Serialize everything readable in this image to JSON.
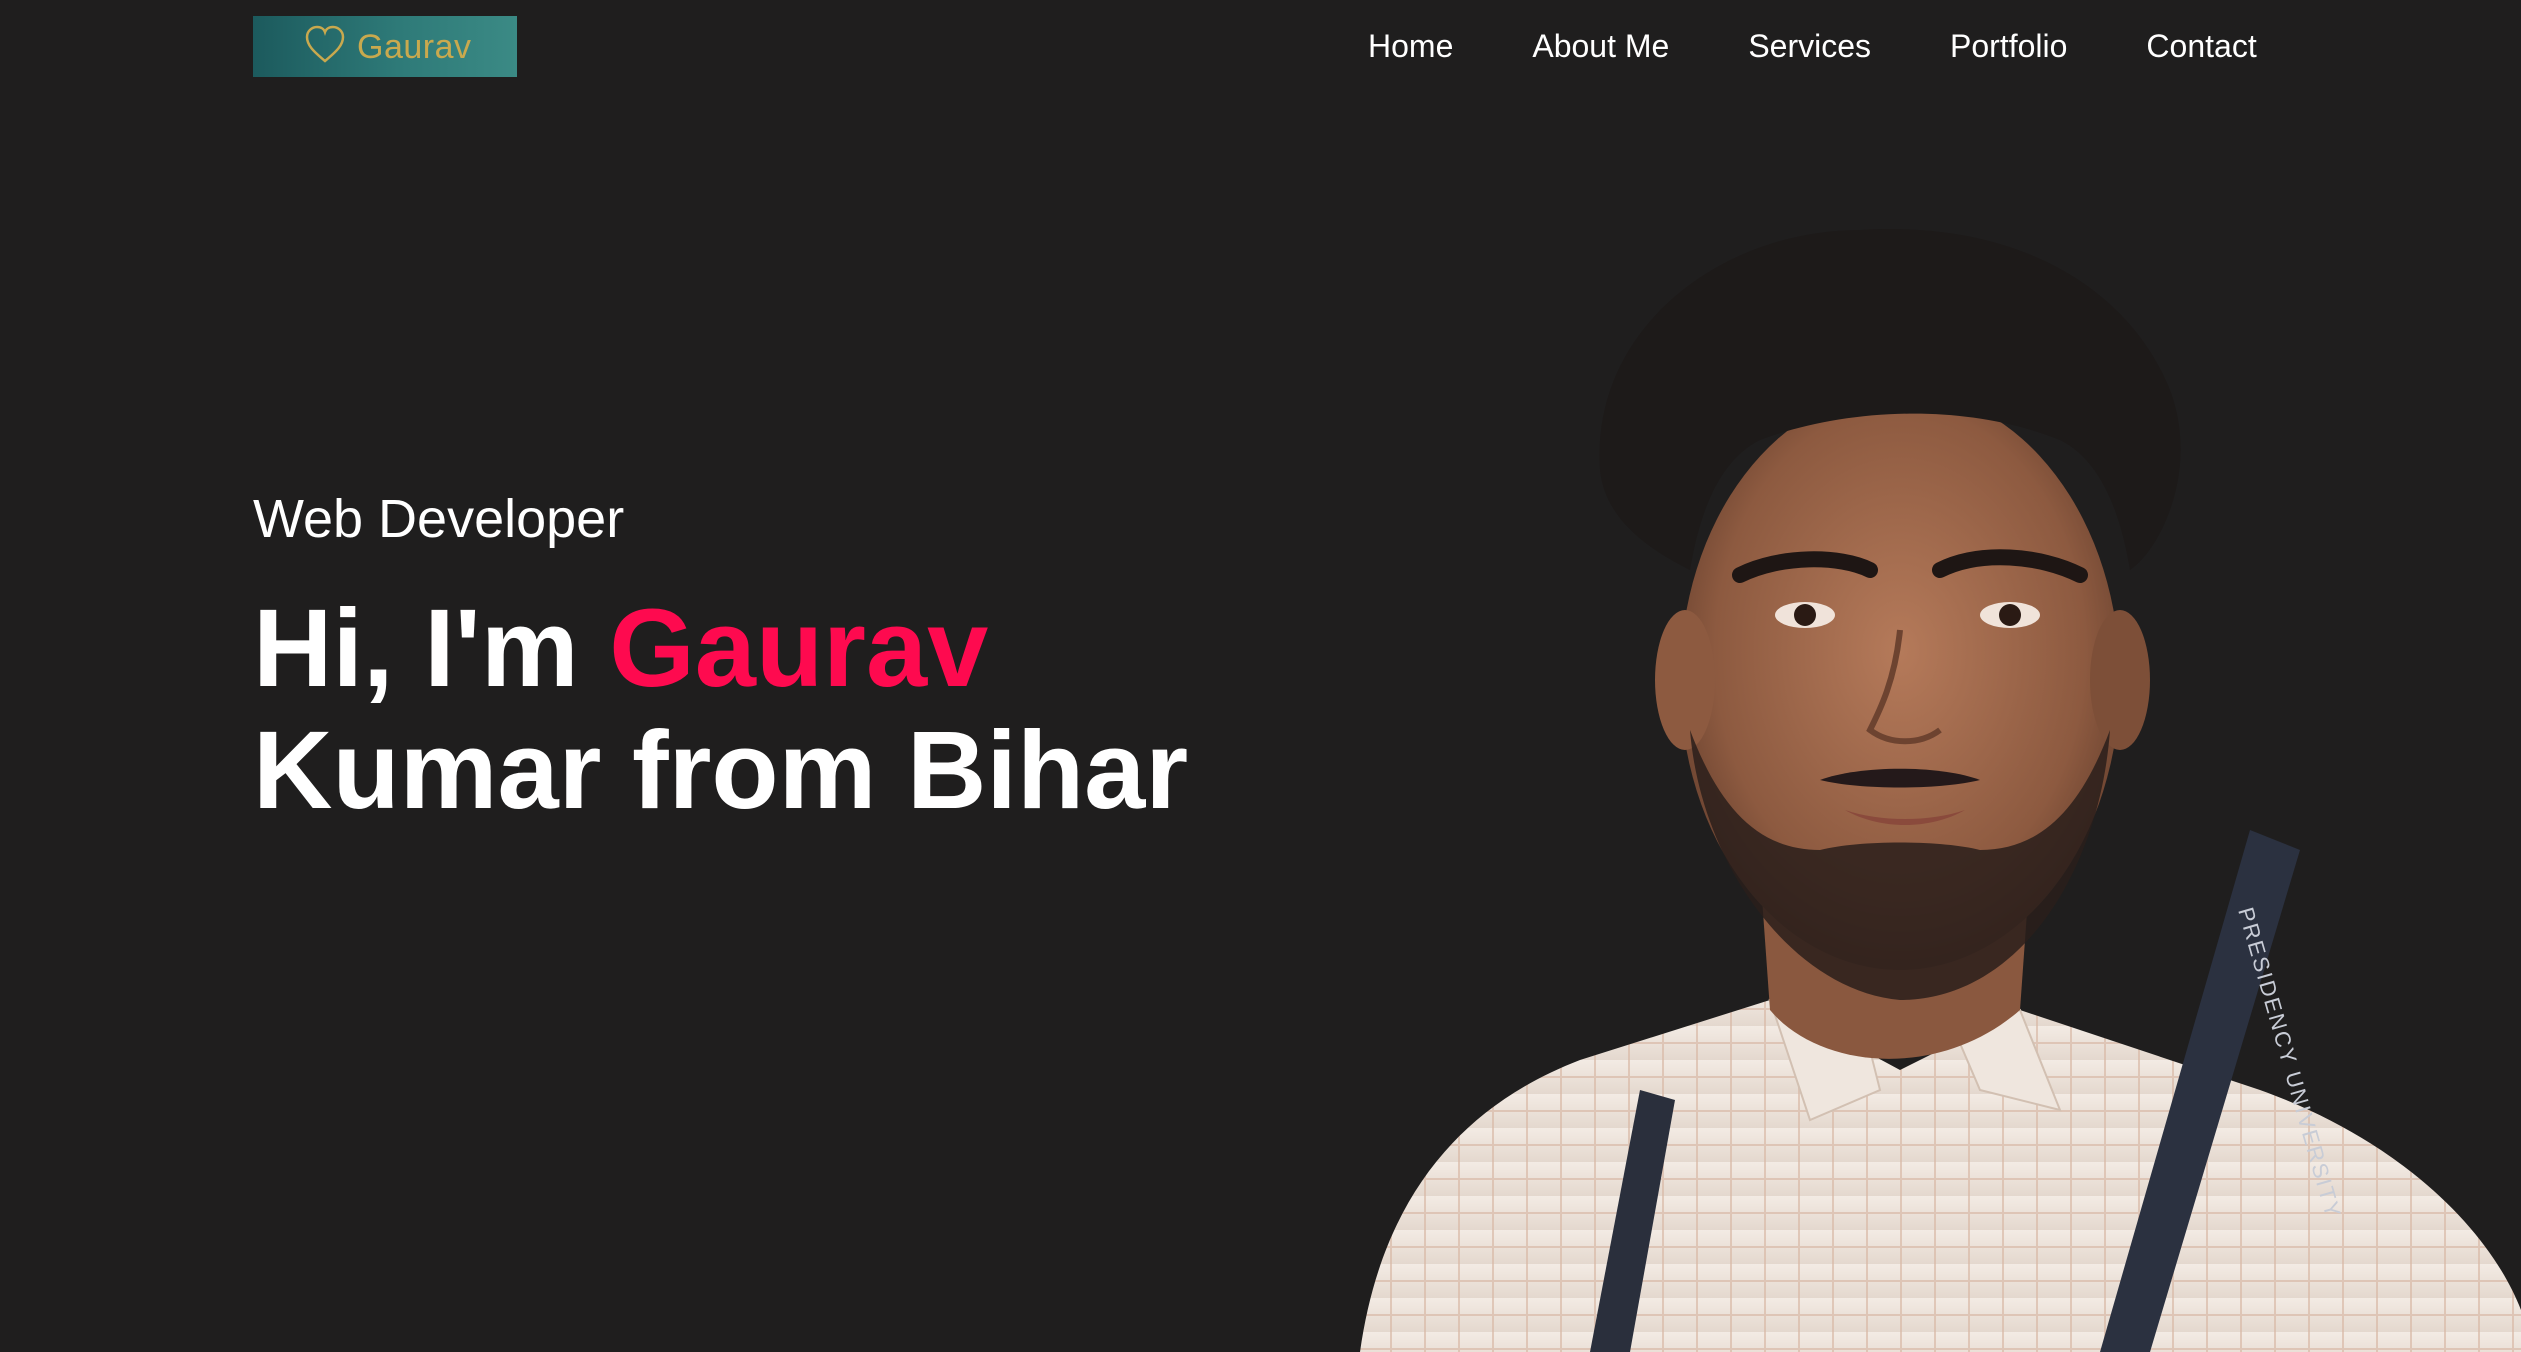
{
  "header": {
    "logo": {
      "text": "Gaurav",
      "icon": "heart-icon",
      "gold_color": "#c9a94e",
      "background_color": "#2a6f70"
    },
    "nav": [
      {
        "label": "Home"
      },
      {
        "label": "About Me"
      },
      {
        "label": "Services"
      },
      {
        "label": "Portfolio"
      },
      {
        "label": "Contact"
      }
    ]
  },
  "hero": {
    "role": "Web Developer",
    "greeting": "Hi, I'm",
    "name": "Gaurav",
    "line2": "Kumar from Bihar",
    "accent_color": "#fe0a4f",
    "portrait": {
      "lanyard_text": "PRESIDENCY UNIVERSITY"
    }
  },
  "theme": {
    "background": "#1f1e1e",
    "text": "#ffffff"
  }
}
